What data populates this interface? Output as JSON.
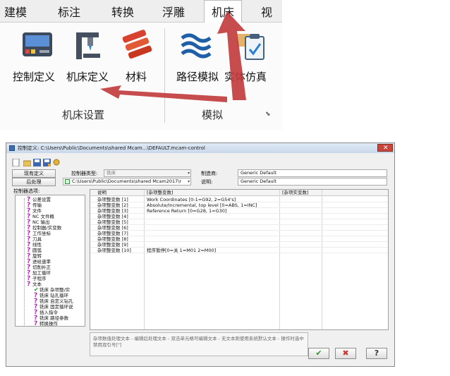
{
  "ribbon": {
    "tabs": [
      {
        "label": "建模"
      },
      {
        "label": "标注"
      },
      {
        "label": "转换"
      },
      {
        "label": "浮雕"
      },
      {
        "label": "机床"
      },
      {
        "label": "视图"
      }
    ],
    "buttons": [
      {
        "label": "控制定义",
        "icon": "controller-icon"
      },
      {
        "label": "机床定义",
        "icon": "machine-icon"
      },
      {
        "label": "材料",
        "icon": "material-icon"
      },
      {
        "label": "路径模拟",
        "icon": "toolpath-sim-icon"
      },
      {
        "label": "实体仿真",
        "icon": "solid-sim-icon"
      }
    ],
    "groups": [
      {
        "label": "机床设置"
      },
      {
        "label": "模拟"
      }
    ],
    "arrow_color": "#c0393b"
  },
  "dialog": {
    "title": "控制定义: C:\\Users\\Public\\Documents\\shared Mcam...\\DEFAULT.mcam-control",
    "current_button": "现有定义",
    "post_button": "后处理",
    "controller_type_label": "控制器类型:",
    "controller_type_value": "铣床",
    "post_path": "C:\\Users\\Public\\Documents\\shared Mcam2017\\r",
    "manufacturer_label": "制造商:",
    "manufacturer_value": "Generic Default",
    "description_label": "说明:",
    "description_value": "Generic Default",
    "options_label": "控制器选项:",
    "tree": [
      {
        "label": "公差设置",
        "mark": "?",
        "indent": 0
      },
      {
        "label": "传输",
        "mark": "?",
        "indent": 0
      },
      {
        "label": "文件",
        "mark": "?",
        "indent": 0
      },
      {
        "label": "NC 文件概",
        "mark": "?",
        "indent": 0
      },
      {
        "label": "NC 输出",
        "mark": "?",
        "indent": 0
      },
      {
        "label": "控制器/实变数",
        "mark": "?",
        "indent": 0
      },
      {
        "label": "工作坐标",
        "mark": "?",
        "indent": 0
      },
      {
        "label": "刀具",
        "mark": "?",
        "indent": 0
      },
      {
        "label": "线性",
        "mark": "?",
        "indent": 0
      },
      {
        "label": "圆弧",
        "mark": "?",
        "indent": 0
      },
      {
        "label": "旋转",
        "mark": "?",
        "indent": 0
      },
      {
        "label": "进给速率",
        "mark": "?",
        "indent": 0
      },
      {
        "label": "切削补正",
        "mark": "?",
        "indent": 0
      },
      {
        "label": "加工循环",
        "mark": "?",
        "indent": 0
      },
      {
        "label": "子程序",
        "mark": "?",
        "indent": 0
      },
      {
        "label": "文本",
        "mark": "?",
        "indent": 0
      },
      {
        "label": "铣床 杂项整/实",
        "mark": "check",
        "indent": 1
      },
      {
        "label": "铣床 钻孔循环",
        "mark": "?",
        "indent": 1
      },
      {
        "label": "铣床 自定义钻孔",
        "mark": "?",
        "indent": 1
      },
      {
        "label": "铣床 固定循环说",
        "mark": "?",
        "indent": 1
      },
      {
        "label": "插入指令",
        "mark": "?",
        "indent": 1
      },
      {
        "label": "铣床 路径参数",
        "mark": "?",
        "indent": 1
      },
      {
        "label": "转换操作",
        "mark": "?",
        "indent": 1
      }
    ],
    "grid": {
      "headers": [
        "说明",
        "[杂项整变数]",
        "[杂项实变数]"
      ],
      "rows": [
        {
          "name": "杂项整变数 [1]",
          "value": "Work Coordinates [0-1=G92, 2=G54's]"
        },
        {
          "name": "杂项整变数 [2]",
          "value": "Absolute/Incremental, top level [0=ABS, 1=INC]"
        },
        {
          "name": "杂项整变数 [3]",
          "value": "Reference Return [0=G28, 1=G30]"
        },
        {
          "name": "杂项整变数 [4]",
          "value": ""
        },
        {
          "name": "杂项整变数 [5]",
          "value": ""
        },
        {
          "name": "杂项整变数 [6]",
          "value": ""
        },
        {
          "name": "杂项整变数 [7]",
          "value": ""
        },
        {
          "name": "杂项整变数 [8]",
          "value": ""
        },
        {
          "name": "杂项整变数 [9]",
          "value": ""
        },
        {
          "name": "杂项整变数 [10]",
          "value": "程序暂停[0=关 1=M01 2=M00]"
        }
      ]
    },
    "help_text": "杂项数值处理文本 - 编辑后处理文本 - 双击单元格可编辑文本 - 无文本则使用系统默认文本 - 操作时选中禁用双引号[\"]",
    "ok_glyph": "✔",
    "cancel_glyph": "✖",
    "help_glyph": "?"
  }
}
